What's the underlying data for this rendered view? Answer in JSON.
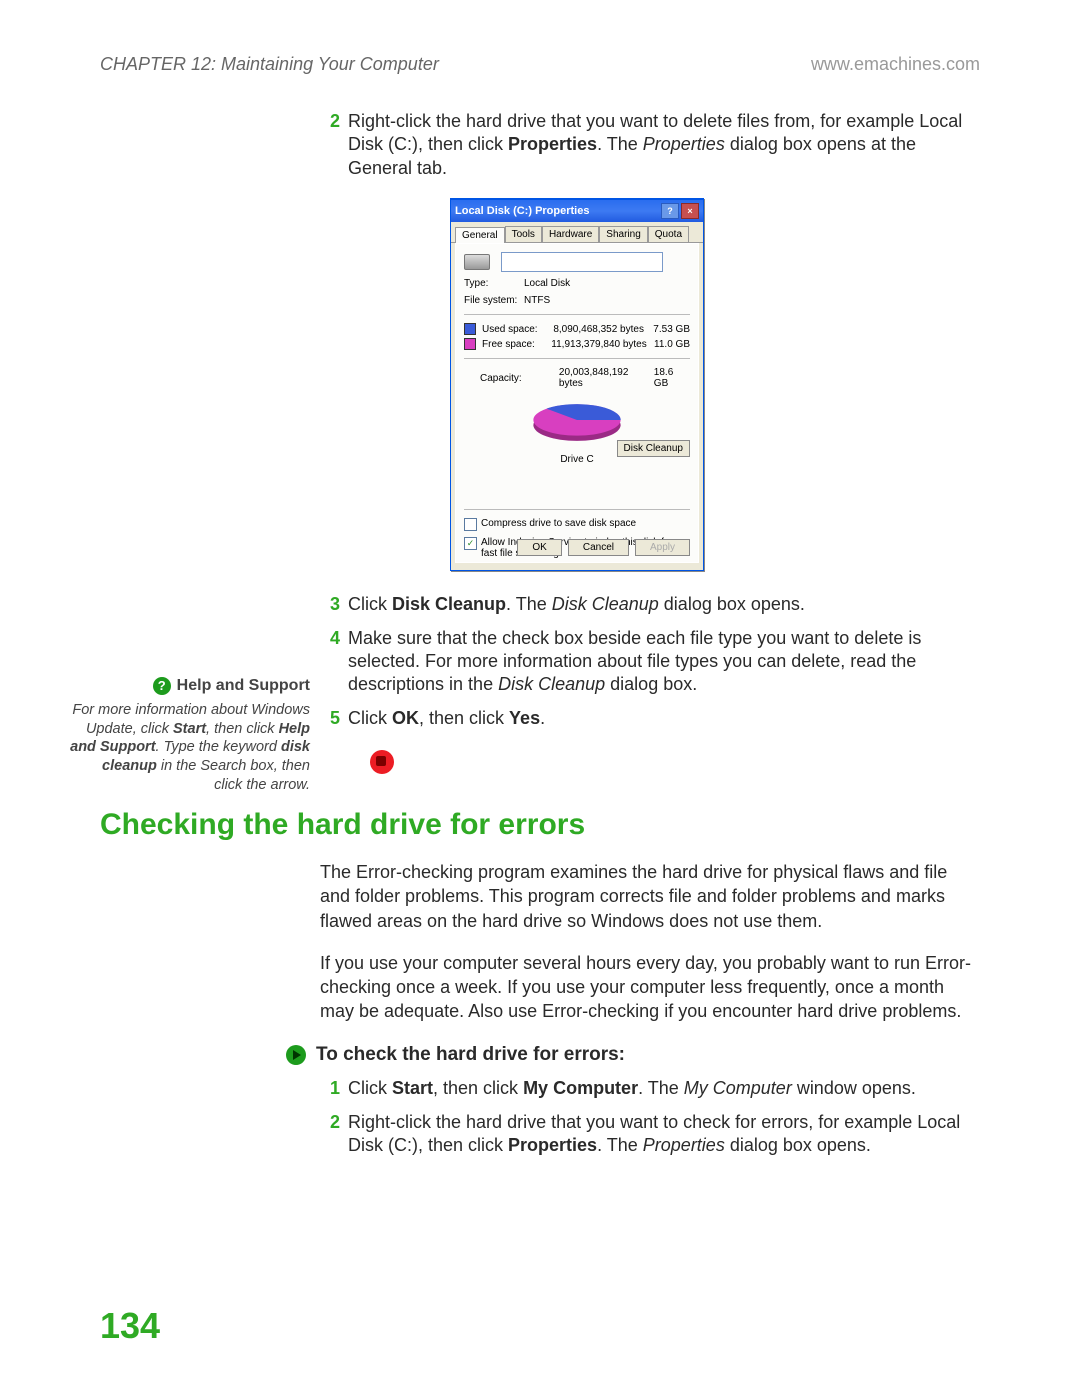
{
  "header": {
    "chapter": "CHAPTER 12: Maintaining Your Computer",
    "url": "www.emachines.com"
  },
  "steps_top": [
    {
      "n": "2",
      "html": "Right-click the hard drive that you want to delete files from, for example Local Disk (C:), then click <b>Properties</b>. The <i>Properties</i> dialog box opens at the General tab."
    }
  ],
  "dialog": {
    "title": "Local Disk (C:) Properties",
    "tabs": [
      "General",
      "Tools",
      "Hardware",
      "Sharing",
      "Quota"
    ],
    "type_label": "Type:",
    "type_value": "Local Disk",
    "fs_label": "File system:",
    "fs_value": "NTFS",
    "used": {
      "label": "Used space:",
      "bytes": "8,090,468,352 bytes",
      "gb": "7.53 GB",
      "color": "#3a5bd8"
    },
    "free": {
      "label": "Free space:",
      "bytes": "11,913,379,840 bytes",
      "gb": "11.0 GB",
      "color": "#d83fc0"
    },
    "capacity": {
      "label": "Capacity:",
      "bytes": "20,003,848,192 bytes",
      "gb": "18.6 GB"
    },
    "drive_caption": "Drive C",
    "disk_cleanup_btn": "Disk Cleanup",
    "check1": "Compress drive to save disk space",
    "check2": "Allow Indexing Service to index this disk for fast file searching",
    "ok": "OK",
    "cancel": "Cancel",
    "apply": "Apply"
  },
  "steps_mid": [
    {
      "n": "3",
      "html": "Click <b>Disk Cleanup</b>. The <i>Disk Cleanup</i> dialog box opens."
    },
    {
      "n": "4",
      "html": "Make sure that the check box beside each file type you want to delete is selected. For more information about file types you can delete, read the descriptions in the <i>Disk Cleanup</i> dialog box."
    },
    {
      "n": "5",
      "html": "Click <b>OK</b>, then click <b>Yes</b>."
    }
  ],
  "help": {
    "title": "Help and Support",
    "body": "For more information about Windows Update, click <b>Start</b>, then click <b>Help and Support</b>. Type the keyword <b>disk cleanup</b> in the Search box, then click the arrow."
  },
  "section": {
    "title": "Checking the hard drive for errors",
    "p1": "The Error-checking program examines the hard drive for physical flaws and file and folder problems. This program corrects file and folder problems and marks flawed areas on the hard drive so Windows does not use them.",
    "p2": "If you use your computer several hours every day, you probably want to run Error-checking once a week. If you use your computer less frequently, once a month may be adequate. Also use Error-checking if you encounter hard drive problems.",
    "proc_title": "To check the hard drive for errors:",
    "steps": [
      {
        "n": "1",
        "html": "Click <b>Start</b>, then click <b>My Computer</b>. The <i>My Computer</i> window opens."
      },
      {
        "n": "2",
        "html": "Right-click the hard drive that you want to check for errors, for example Local Disk (C:), then click <b>Properties</b>. The <i>Properties</i> dialog box opens."
      }
    ]
  },
  "page_number": "134"
}
